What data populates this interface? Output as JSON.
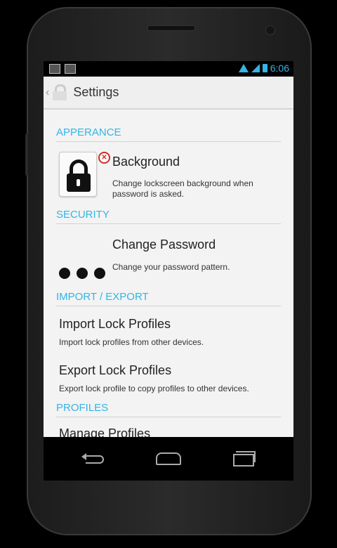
{
  "status_bar": {
    "time": "6:06"
  },
  "action_bar": {
    "title": "Settings"
  },
  "sections": {
    "appearance": "APPERANCE",
    "security": "SECURITY",
    "import_export": "IMPORT / EXPORT",
    "profiles": "PROFILES"
  },
  "prefs": {
    "background": {
      "title": "Background",
      "summary": "Change lockscreen background when password is asked."
    },
    "change_password": {
      "title": "Change Password",
      "summary": "Change your password pattern."
    },
    "import_profiles": {
      "title": "Import Lock Profiles",
      "summary": "Import lock profiles from other devices."
    },
    "export_profiles": {
      "title": "Export Lock Profiles",
      "summary": "Export lock profile to copy profiles to other devices."
    },
    "manage_profiles": {
      "title": "Manage Profiles"
    }
  },
  "colors": {
    "accent": "#33b5e5",
    "background": "#f3f3f3",
    "error_badge": "#d0302a"
  },
  "icons": [
    "gmail-icon",
    "gallery-icon",
    "wifi-icon",
    "signal-icon",
    "battery-icon",
    "lock-app-icon",
    "lock-icon",
    "remove-badge-icon",
    "back-icon",
    "home-icon",
    "recent-apps-icon"
  ]
}
